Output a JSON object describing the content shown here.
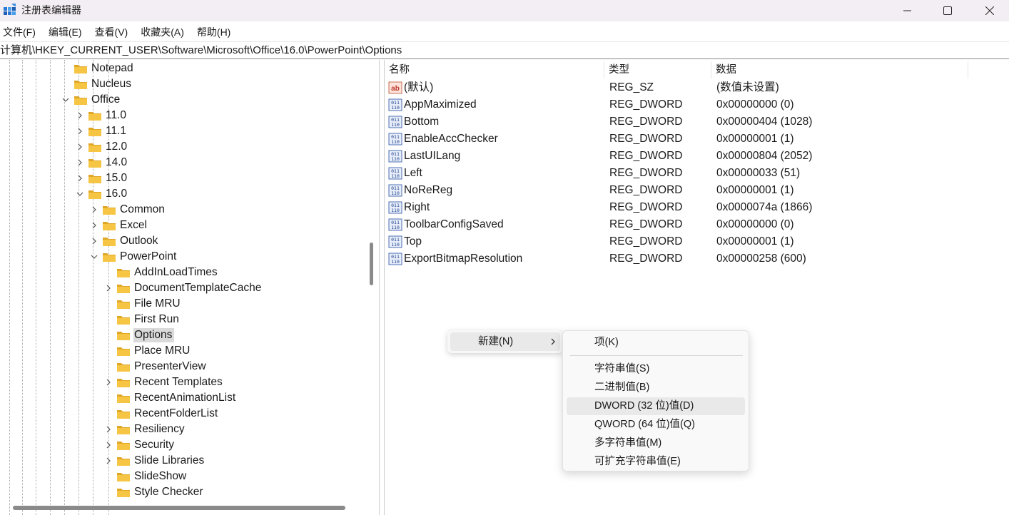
{
  "window": {
    "title": "注册表编辑器"
  },
  "menu": [
    "文件(F)",
    "编辑(E)",
    "查看(V)",
    "收藏夹(A)",
    "帮助(H)"
  ],
  "address": "计算机\\HKEY_CURRENT_USER\\Software\\Microsoft\\Office\\16.0\\PowerPoint\\Options",
  "tree": {
    "items": [
      {
        "label": "Notepad",
        "level": 0,
        "expander": "none"
      },
      {
        "label": "Nucleus",
        "level": 0,
        "expander": "none"
      },
      {
        "label": "Office",
        "level": 0,
        "expander": "expanded"
      },
      {
        "label": "11.0",
        "level": 1,
        "expander": "collapsed"
      },
      {
        "label": "11.1",
        "level": 1,
        "expander": "collapsed"
      },
      {
        "label": "12.0",
        "level": 1,
        "expander": "collapsed"
      },
      {
        "label": "14.0",
        "level": 1,
        "expander": "collapsed"
      },
      {
        "label": "15.0",
        "level": 1,
        "expander": "collapsed"
      },
      {
        "label": "16.0",
        "level": 1,
        "expander": "expanded"
      },
      {
        "label": "Common",
        "level": 2,
        "expander": "collapsed"
      },
      {
        "label": "Excel",
        "level": 2,
        "expander": "collapsed"
      },
      {
        "label": "Outlook",
        "level": 2,
        "expander": "collapsed"
      },
      {
        "label": "PowerPoint",
        "level": 2,
        "expander": "expanded"
      },
      {
        "label": "AddInLoadTimes",
        "level": 3,
        "expander": "none"
      },
      {
        "label": "DocumentTemplateCache",
        "level": 3,
        "expander": "collapsed"
      },
      {
        "label": "File MRU",
        "level": 3,
        "expander": "none"
      },
      {
        "label": "First Run",
        "level": 3,
        "expander": "none"
      },
      {
        "label": "Options",
        "level": 3,
        "expander": "none",
        "selected": true
      },
      {
        "label": "Place MRU",
        "level": 3,
        "expander": "none"
      },
      {
        "label": "PresenterView",
        "level": 3,
        "expander": "none"
      },
      {
        "label": "Recent Templates",
        "level": 3,
        "expander": "collapsed"
      },
      {
        "label": "RecentAnimationList",
        "level": 3,
        "expander": "none"
      },
      {
        "label": "RecentFolderList",
        "level": 3,
        "expander": "none"
      },
      {
        "label": "Resiliency",
        "level": 3,
        "expander": "collapsed"
      },
      {
        "label": "Security",
        "level": 3,
        "expander": "collapsed"
      },
      {
        "label": "Slide Libraries",
        "level": 3,
        "expander": "collapsed"
      },
      {
        "label": "SlideShow",
        "level": 3,
        "expander": "none"
      },
      {
        "label": "Style Checker",
        "level": 3,
        "expander": "none"
      }
    ]
  },
  "values": {
    "headers": {
      "name": "名称",
      "type": "类型",
      "data": "数据"
    },
    "rows": [
      {
        "name": "(默认)",
        "type": "REG_SZ",
        "data": "(数值未设置)",
        "icon": "string-value-icon"
      },
      {
        "name": "AppMaximized",
        "type": "REG_DWORD",
        "data": "0x00000000 (0)",
        "icon": "binary-value-icon"
      },
      {
        "name": "Bottom",
        "type": "REG_DWORD",
        "data": "0x00000404 (1028)",
        "icon": "binary-value-icon"
      },
      {
        "name": "EnableAccChecker",
        "type": "REG_DWORD",
        "data": "0x00000001 (1)",
        "icon": "binary-value-icon"
      },
      {
        "name": "LastUILang",
        "type": "REG_DWORD",
        "data": "0x00000804 (2052)",
        "icon": "binary-value-icon"
      },
      {
        "name": "Left",
        "type": "REG_DWORD",
        "data": "0x00000033 (51)",
        "icon": "binary-value-icon"
      },
      {
        "name": "NoReReg",
        "type": "REG_DWORD",
        "data": "0x00000001 (1)",
        "icon": "binary-value-icon"
      },
      {
        "name": "Right",
        "type": "REG_DWORD",
        "data": "0x0000074a (1866)",
        "icon": "binary-value-icon"
      },
      {
        "name": "ToolbarConfigSaved",
        "type": "REG_DWORD",
        "data": "0x00000000 (0)",
        "icon": "binary-value-icon"
      },
      {
        "name": "Top",
        "type": "REG_DWORD",
        "data": "0x00000001 (1)",
        "icon": "binary-value-icon"
      },
      {
        "name": "ExportBitmapResolution",
        "type": "REG_DWORD",
        "data": "0x00000258 (600)",
        "icon": "binary-value-icon"
      }
    ]
  },
  "context_menu": {
    "new_label": "新建(N)",
    "submenu": {
      "key": "项(K)",
      "items": [
        {
          "label": "字符串值(S)"
        },
        {
          "label": "二进制值(B)"
        },
        {
          "label": "DWORD (32 位)值(D)",
          "hover": true
        },
        {
          "label": "QWORD (64 位)值(Q)"
        },
        {
          "label": "多字符串值(M)"
        },
        {
          "label": "可扩充字符串值(E)"
        }
      ]
    }
  },
  "colors": {
    "folder": "#f6c544",
    "folder_dark": "#e0a626",
    "selection": "#dadada",
    "titlebar": "#f3eef3"
  }
}
